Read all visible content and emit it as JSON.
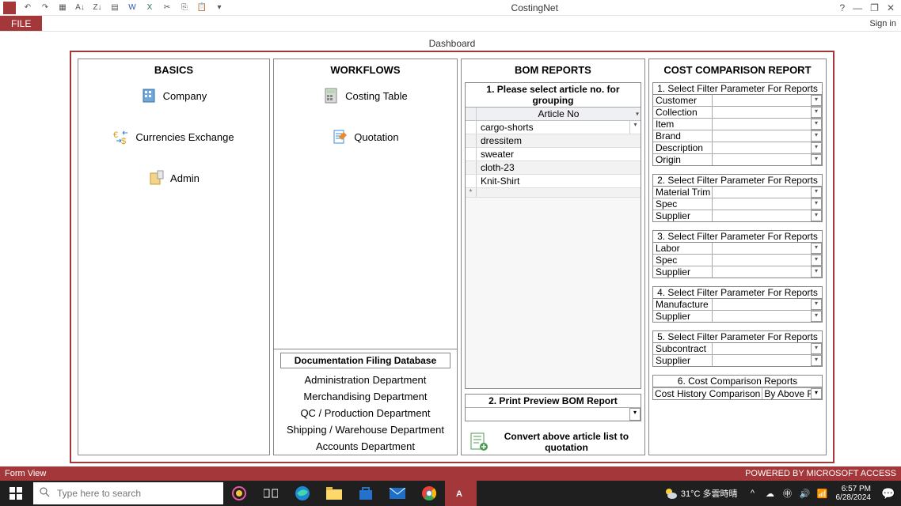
{
  "app": {
    "title": "CostingNet",
    "help": "?",
    "signin": "Sign in"
  },
  "tabs": {
    "file": "FILE"
  },
  "dashboard_label": "Dashboard",
  "basics": {
    "header": "BASICS",
    "company": "Company",
    "currencies": "Currencies Exchange",
    "admin": "Admin"
  },
  "workflows": {
    "header": "WORKFLOWS",
    "costing_table": "Costing Table",
    "quotation": "Quotation"
  },
  "doc_db": {
    "header": "Documentation Filing Database",
    "items": [
      "Administration Department",
      "Merchandising Department",
      "QC / Production Department",
      "Shipping / Warehouse Department",
      "Accounts Department"
    ]
  },
  "bom": {
    "header": "BOM REPORTS",
    "sec1_title": "1. Please select article no. for grouping",
    "article_col": "Article No",
    "rows": [
      "cargo-shorts",
      "dressitem",
      "sweater",
      "cloth-23",
      "Knit-Shirt"
    ],
    "sec2_title": "2. Print Preview BOM Report",
    "convert": "Convert above article list to quotation"
  },
  "cc": {
    "header": "COST COMPARISON REPORT",
    "sec1": {
      "title": "1. Select Filter Parameter For Reports",
      "rows": [
        "Customer",
        "Collection",
        "Item",
        "Brand",
        "Description",
        "Origin"
      ]
    },
    "sec2": {
      "title": "2. Select Filter Parameter For Reports",
      "rows": [
        "Material Trim",
        "Spec",
        "Supplier"
      ]
    },
    "sec3": {
      "title": "3. Select Filter Parameter For Reports",
      "rows": [
        "Labor",
        "Spec",
        "Supplier"
      ]
    },
    "sec4": {
      "title": "4. Select Filter Parameter For Reports",
      "rows": [
        "Manufacture",
        "Supplier"
      ]
    },
    "sec5": {
      "title": "5. Select Filter Parameter For Reports",
      "rows": [
        "Subcontract",
        "Supplier"
      ]
    },
    "sec6": {
      "title": "6. Cost Comparison Reports",
      "c1": "Cost History Comparison",
      "c2": "By Above Filt"
    }
  },
  "status": {
    "left": "Form View",
    "right": "POWERED BY MICROSOFT ACCESS"
  },
  "taskbar": {
    "search_placeholder": "Type here to search",
    "weather": "31°C  多雲時晴",
    "time": "6:57 PM",
    "date": "6/28/2024"
  }
}
